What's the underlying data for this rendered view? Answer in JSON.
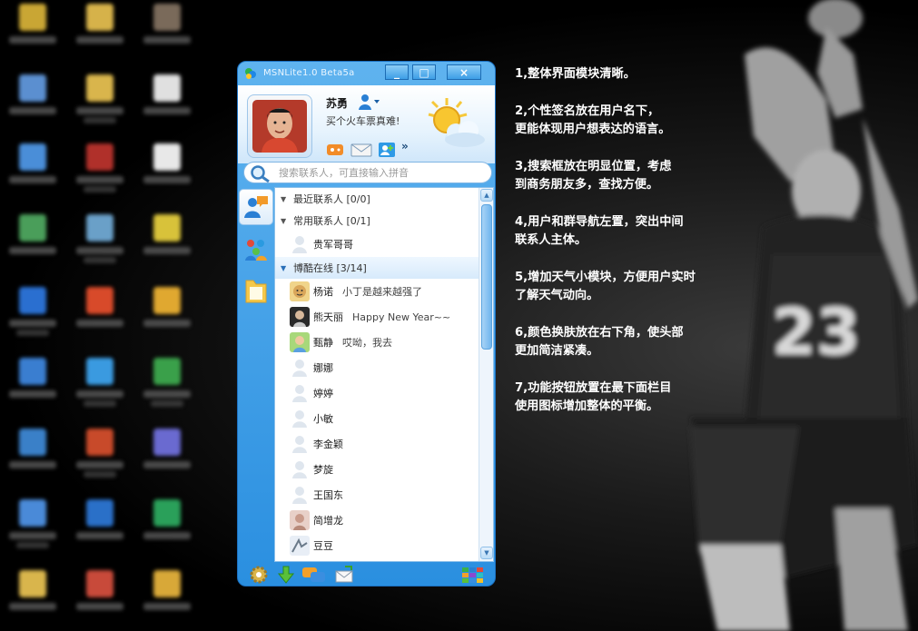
{
  "window": {
    "title": "MSNLite1.0 Beta5a",
    "minimize_label": "_",
    "maximize_label": "□",
    "close_label": "×"
  },
  "profile": {
    "name": "苏勇",
    "signature": "买个火车票真难!"
  },
  "search": {
    "placeholder": "搜索联系人，可直接输入拼音"
  },
  "groups": [
    {
      "label": "最近联系人 [0/0]",
      "state": "collapsed"
    },
    {
      "label": "常用联系人 [0/1]",
      "state": "expanded"
    },
    {
      "label": "博酷在线 [3/14]",
      "state": "expanded"
    }
  ],
  "frequent_contacts": [
    {
      "name": "贵军哥哥",
      "status": "offline"
    }
  ],
  "online_contacts": [
    {
      "name": "杨诺",
      "message": "小丁是越来越强了",
      "status": "online"
    },
    {
      "name": "熊天丽",
      "message": "Happy New Year~~",
      "status": "online"
    },
    {
      "name": "甄静",
      "message": "哎呦，我去",
      "status": "online"
    },
    {
      "name": "娜娜",
      "message": "",
      "status": "offline"
    },
    {
      "name": "婷婷",
      "message": "",
      "status": "offline"
    },
    {
      "name": "小敏",
      "message": "",
      "status": "offline"
    },
    {
      "name": "李金颖",
      "message": "",
      "status": "offline"
    },
    {
      "name": "梦旋",
      "message": "",
      "status": "offline"
    },
    {
      "name": "王国东",
      "message": "",
      "status": "offline"
    },
    {
      "name": "简增龙",
      "message": "",
      "status": "offline"
    },
    {
      "name": "豆豆",
      "message": "",
      "status": "offline"
    }
  ],
  "notes": [
    "1,整体界面模块清晰。",
    "2,个性签名放在用户名下，\n更能体现用户想表达的语言。",
    "3,搜索框放在明显位置，考虑\n到商务朋友多，查找方便。",
    "4,用户和群导航左置，突出中间\n联系人主体。",
    "5,增加天气小模块，方便用户实时\n了解天气动向。",
    "6,颜色换肤放在右下角，使头部\n更加简洁紧凑。",
    "7,功能按钮放置在最下面栏目\n使用图标增加整体的平衡。"
  ],
  "colors": {
    "window_blue": "#2a8fe0",
    "header_light": "#e6f3fd",
    "background": "#000000"
  }
}
